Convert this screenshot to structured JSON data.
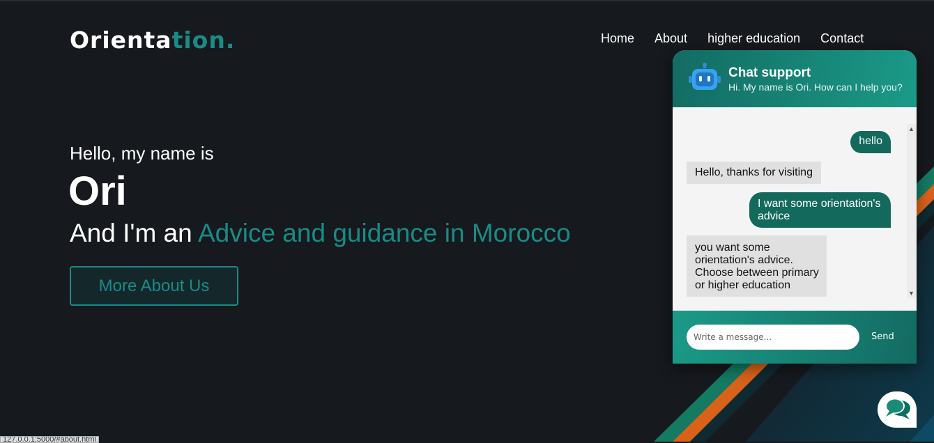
{
  "logo": {
    "main": "Orienta",
    "accent": "tion."
  },
  "nav": {
    "items": [
      "Home",
      "About",
      "higher education",
      "Contact"
    ]
  },
  "hero": {
    "greeting": "Hello, my name is",
    "name": "Ori",
    "role_prefix": "And I'm an",
    "role_highlight": "Advice and guidance in Morocco",
    "button_label": "More About Us"
  },
  "chat": {
    "title": "Chat support",
    "subtitle": "Hi. My name is Ori. How can I help you?",
    "messages": [
      {
        "from": "user",
        "text": "hello"
      },
      {
        "from": "bot",
        "text": "Hello, thanks for visiting"
      },
      {
        "from": "user",
        "text": "I want some orientation's advice"
      },
      {
        "from": "bot",
        "text": "you want some orientation's advice. Choose between primary or higher education"
      }
    ],
    "input_placeholder": "Write a message...",
    "send_label": "Send"
  },
  "status_bar": {
    "url": "127.0.0.1:5000/#about.html"
  },
  "colors": {
    "accent": "#1a8b86",
    "background": "#16191d",
    "chat_teal": "#136a5c"
  },
  "icons": {
    "chat_header": "robot-icon",
    "chat_toggle": "chat-bubbles-icon"
  }
}
